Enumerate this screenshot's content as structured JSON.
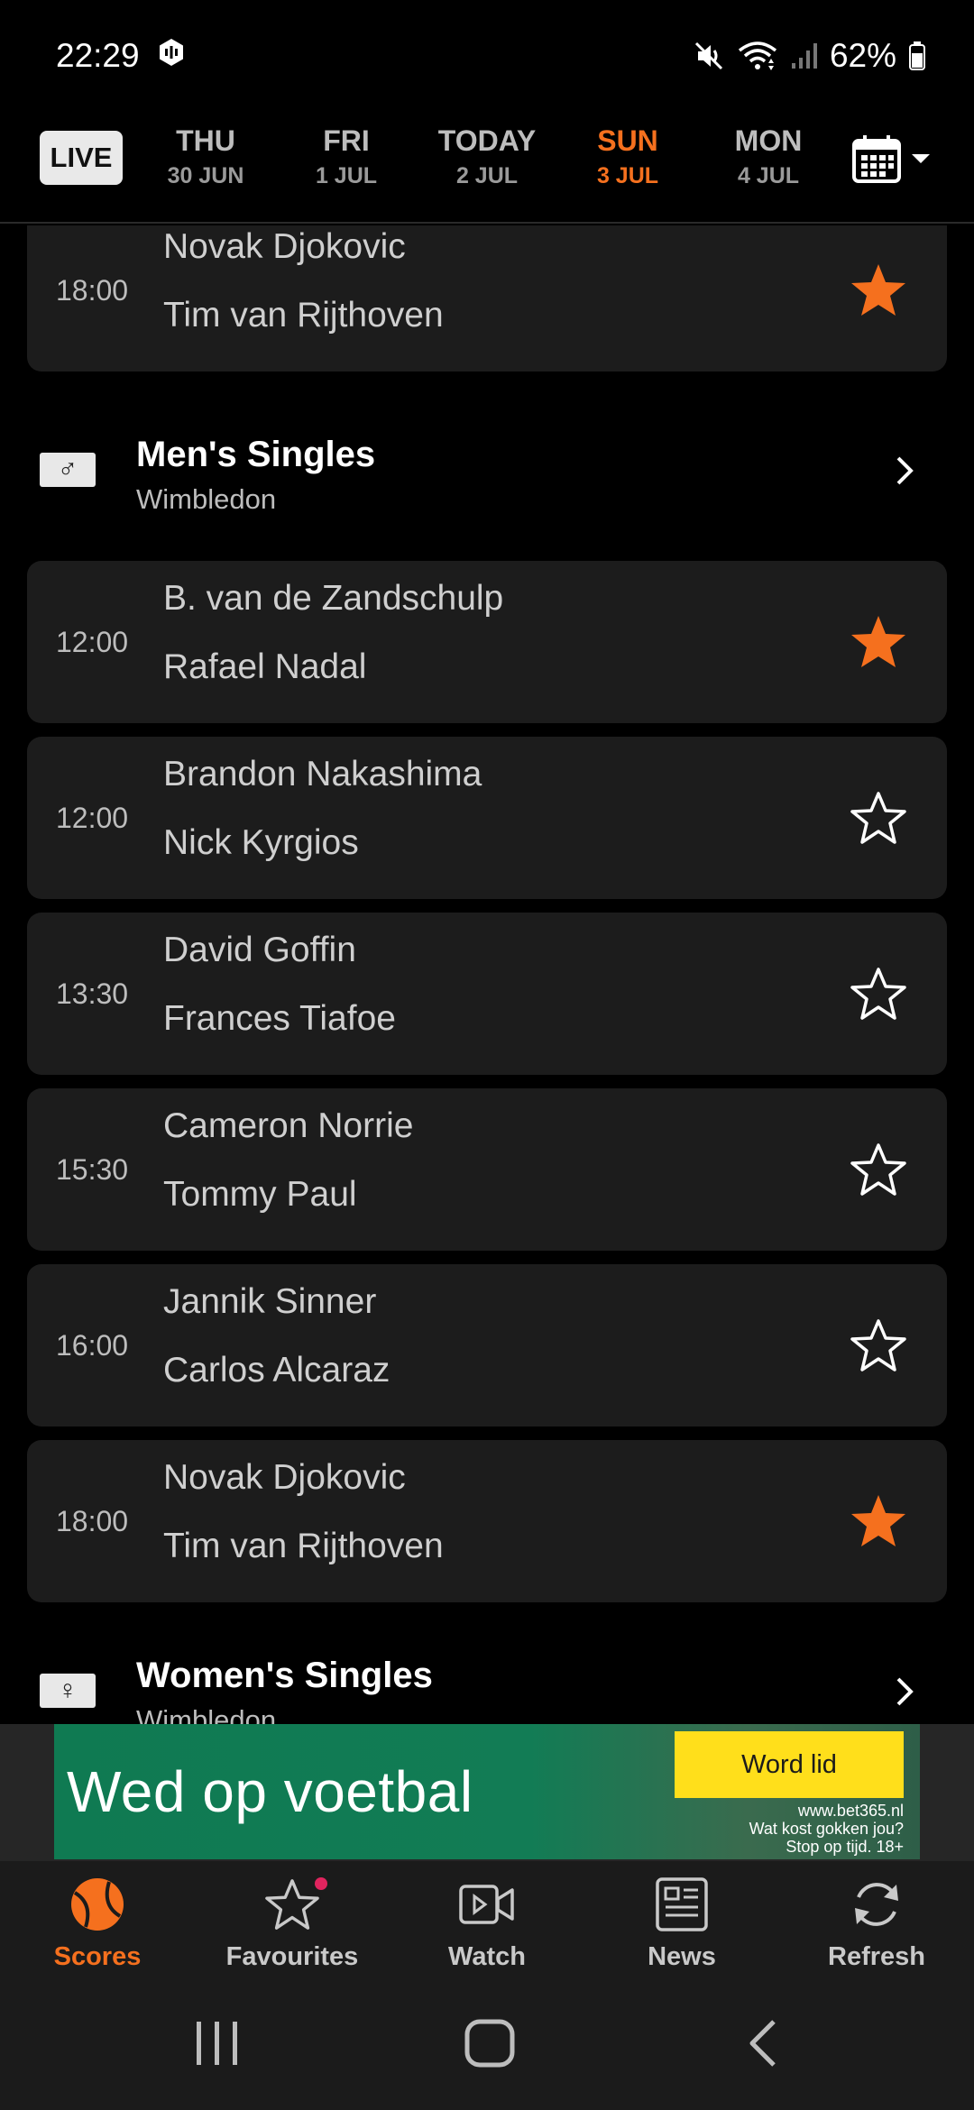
{
  "status_bar": {
    "time": "22:29",
    "battery": "62%"
  },
  "date_bar": {
    "live_label": "LIVE",
    "days": [
      {
        "name": "THU",
        "date": "30 JUN"
      },
      {
        "name": "FRI",
        "date": "1 JUL"
      },
      {
        "name": "TODAY",
        "date": "2 JUL"
      },
      {
        "name": "SUN",
        "date": "3 JUL",
        "active": true
      },
      {
        "name": "MON",
        "date": "4 JUL"
      }
    ]
  },
  "matches_top": [
    {
      "time": "18:00",
      "player1": "Novak Djokovic",
      "player2": "Tim van Rijthoven",
      "favourite": true
    }
  ],
  "sections": [
    {
      "gender": "male",
      "title": "Men's Singles",
      "subtitle": "Wimbledon",
      "matches": [
        {
          "time": "12:00",
          "player1": "B. van de Zandschulp",
          "player2": "Rafael Nadal",
          "favourite": true
        },
        {
          "time": "12:00",
          "player1": "Brandon Nakashima",
          "player2": "Nick Kyrgios",
          "favourite": false
        },
        {
          "time": "13:30",
          "player1": "David Goffin",
          "player2": "Frances Tiafoe",
          "favourite": false
        },
        {
          "time": "15:30",
          "player1": "Cameron Norrie",
          "player2": "Tommy Paul",
          "favourite": false
        },
        {
          "time": "16:00",
          "player1": "Jannik Sinner",
          "player2": "Carlos Alcaraz",
          "favourite": false
        },
        {
          "time": "18:00",
          "player1": "Novak Djokovic",
          "player2": "Tim van Rijthoven",
          "favourite": true
        }
      ]
    },
    {
      "gender": "female",
      "title": "Women's Singles",
      "subtitle": "Wimbledon"
    }
  ],
  "ad": {
    "headline": "Wed op voetbal",
    "cta": "Word lid",
    "small_lines": [
      "www.bet365.nl",
      "Wat kost gokken jou?",
      "Stop op tijd. 18+"
    ]
  },
  "bottom_nav": [
    {
      "label": "Scores",
      "icon": "tennis-ball-icon",
      "active": true
    },
    {
      "label": "Favourites",
      "icon": "star-icon",
      "notification": true
    },
    {
      "label": "Watch",
      "icon": "video-icon"
    },
    {
      "label": "News",
      "icon": "newspaper-icon"
    },
    {
      "label": "Refresh",
      "icon": "refresh-icon"
    }
  ],
  "colors": {
    "accent": "#f5701e",
    "card": "#1c1c1c",
    "background": "#000000",
    "ad_green": "#127c55",
    "ad_cta": "#ffdf1b"
  }
}
